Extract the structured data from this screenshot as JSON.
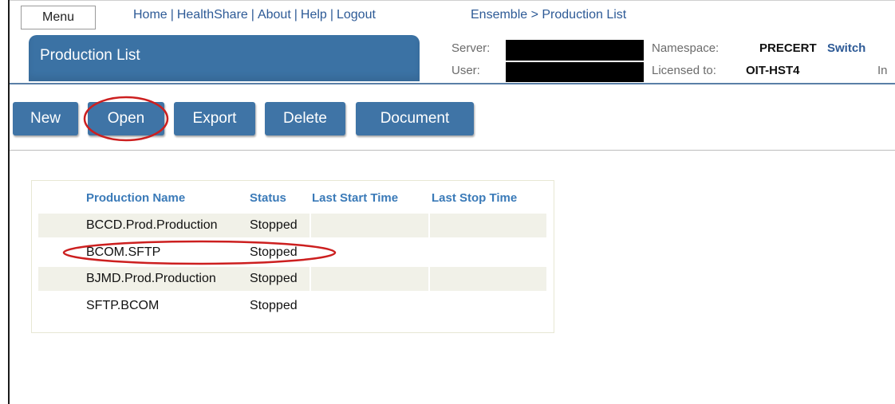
{
  "header": {
    "menu_label": "Menu",
    "nav_links": [
      "Home",
      "HealthShare",
      "About",
      "Help",
      "Logout"
    ],
    "nav_separator": "|",
    "breadcrumb": "Ensemble > Production List",
    "page_title": "Production List",
    "server_label": "Server:",
    "user_label": "User:",
    "namespace_label": "Namespace:",
    "namespace_value": "PRECERT",
    "switch_label": "Switch",
    "licensed_label": "Licensed to:",
    "licensed_value": "OIT-HST4",
    "cut_text": "In"
  },
  "toolbar": {
    "new_label": "New",
    "open_label": "Open",
    "export_label": "Export",
    "delete_label": "Delete",
    "document_label": "Document"
  },
  "productions": {
    "columns": [
      "Production Name",
      "Status",
      "Last Start Time",
      "Last Stop Time"
    ],
    "rows": [
      {
        "name": "BCCD.Prod.Production",
        "status": "Stopped",
        "last_start": "",
        "last_stop": ""
      },
      {
        "name": "BCOM.SFTP",
        "status": "Stopped",
        "last_start": "",
        "last_stop": ""
      },
      {
        "name": "BJMD.Prod.Production",
        "status": "Stopped",
        "last_start": "",
        "last_stop": ""
      },
      {
        "name": "SFTP.BCOM",
        "status": "Stopped",
        "last_start": "",
        "last_stop": ""
      }
    ]
  },
  "colors": {
    "accent": "#3f74a6",
    "link": "#2d5a96",
    "column_header": "#3a7ab8",
    "row_shade": "#f1f1e8",
    "annotation": "#cc1f1f",
    "redaction": "#000000"
  }
}
